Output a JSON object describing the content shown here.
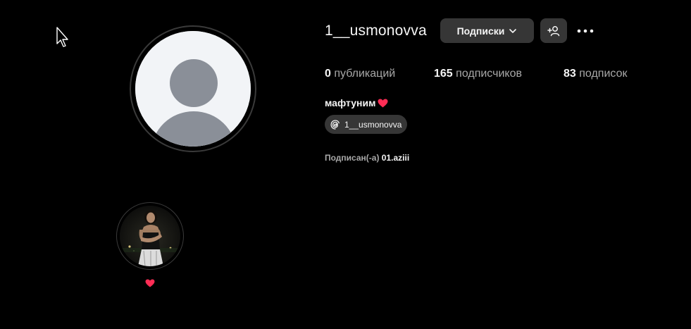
{
  "profile": {
    "username": "1__usmonovva",
    "follow_button_label": "Подписки",
    "stats": {
      "posts_count": "0",
      "posts_label": "публикаций",
      "followers_count": "165",
      "followers_label": "подписчиков",
      "following_count": "83",
      "following_label": "подписок"
    },
    "full_name": "мафтуним",
    "threads_handle": "1__usmonovva",
    "followed_by_prefix": "Подписан(-а)",
    "followed_by_user": "01.aziii"
  },
  "highlights": [
    {
      "label": "heart-emoji"
    }
  ],
  "colors": {
    "background": "#000000",
    "button_bg": "#363636",
    "text_primary": "#f5f5f5",
    "text_secondary": "#a8a8a8",
    "heart": "#ff2d55"
  },
  "icons": {
    "cursor": "arrow-cursor-icon",
    "chevron": "chevron-down-icon",
    "add_user": "add-user-icon",
    "more": "more-horizontal-icon",
    "threads": "threads-icon",
    "heart": "heart-icon",
    "avatar": "default-avatar-icon"
  }
}
